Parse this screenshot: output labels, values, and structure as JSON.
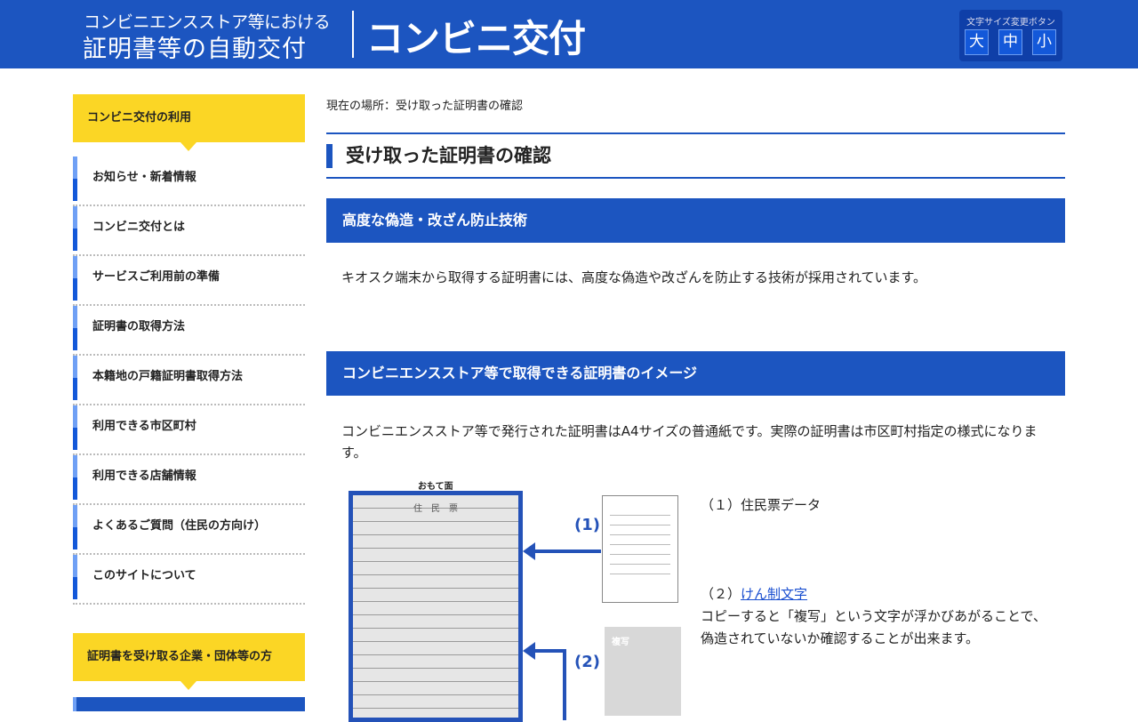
{
  "header": {
    "subtitle": "コンビニエンスストア等における",
    "main": "証明書等の自動交付",
    "title": "コンビニ交付",
    "font_size": {
      "label": "文字サイズ変更ボタン",
      "large": "大",
      "medium": "中",
      "small": "小"
    }
  },
  "sidebar": {
    "section1": "コンビニ交付の利用",
    "items": [
      {
        "label": "お知らせ・新着情報"
      },
      {
        "label": "コンビニ交付とは"
      },
      {
        "label": "サービスご利用前の準備"
      },
      {
        "label": "証明書の取得方法"
      },
      {
        "label": "本籍地の戸籍証明書取得方法"
      },
      {
        "label": "利用できる市区町村"
      },
      {
        "label": "利用できる店舗情報"
      },
      {
        "label": "よくあるご質問（住民の方向け）"
      },
      {
        "label": "このサイトについて"
      }
    ],
    "section2": "証明書を受け取る企業・団体等の方"
  },
  "main": {
    "breadcrumb": "現在の場所：受け取った証明書の確認",
    "title": "受け取った証明書の確認",
    "sec1": {
      "heading": "高度な偽造・改ざん防止技術",
      "text": "キオスク端末から取得する証明書には、高度な偽造や改ざんを防止する技術が採用されています。"
    },
    "sec2": {
      "heading": "コンビニエンスストア等で取得できる証明書のイメージ",
      "text": "コンビニエンスストア等で発行された証明書はA4サイズの普通紙です。実際の証明書は市区町村指定の様式になります。"
    },
    "figure": {
      "caption": "おもて面",
      "doc_title": "住　民　票",
      "label1": "(1)",
      "label2": "(2)",
      "watermark": "複写"
    },
    "items": [
      {
        "num": "（１）",
        "label": "住民票データ"
      },
      {
        "num": "（２）",
        "link": "けん制文字",
        "desc": "コピーすると「複写」という文字が浮かびあがることで、偽造されていないか確認することが出来ます。"
      }
    ]
  }
}
